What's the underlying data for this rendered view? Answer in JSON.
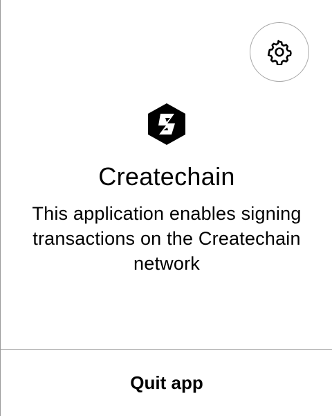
{
  "app": {
    "name": "Createchain",
    "description": "This application enables signing transactions on the Createchain network",
    "logo_icon": "createchain-hexagon-logo"
  },
  "header": {
    "settings_icon": "gear-icon"
  },
  "footer": {
    "quit_label": "Quit app"
  }
}
